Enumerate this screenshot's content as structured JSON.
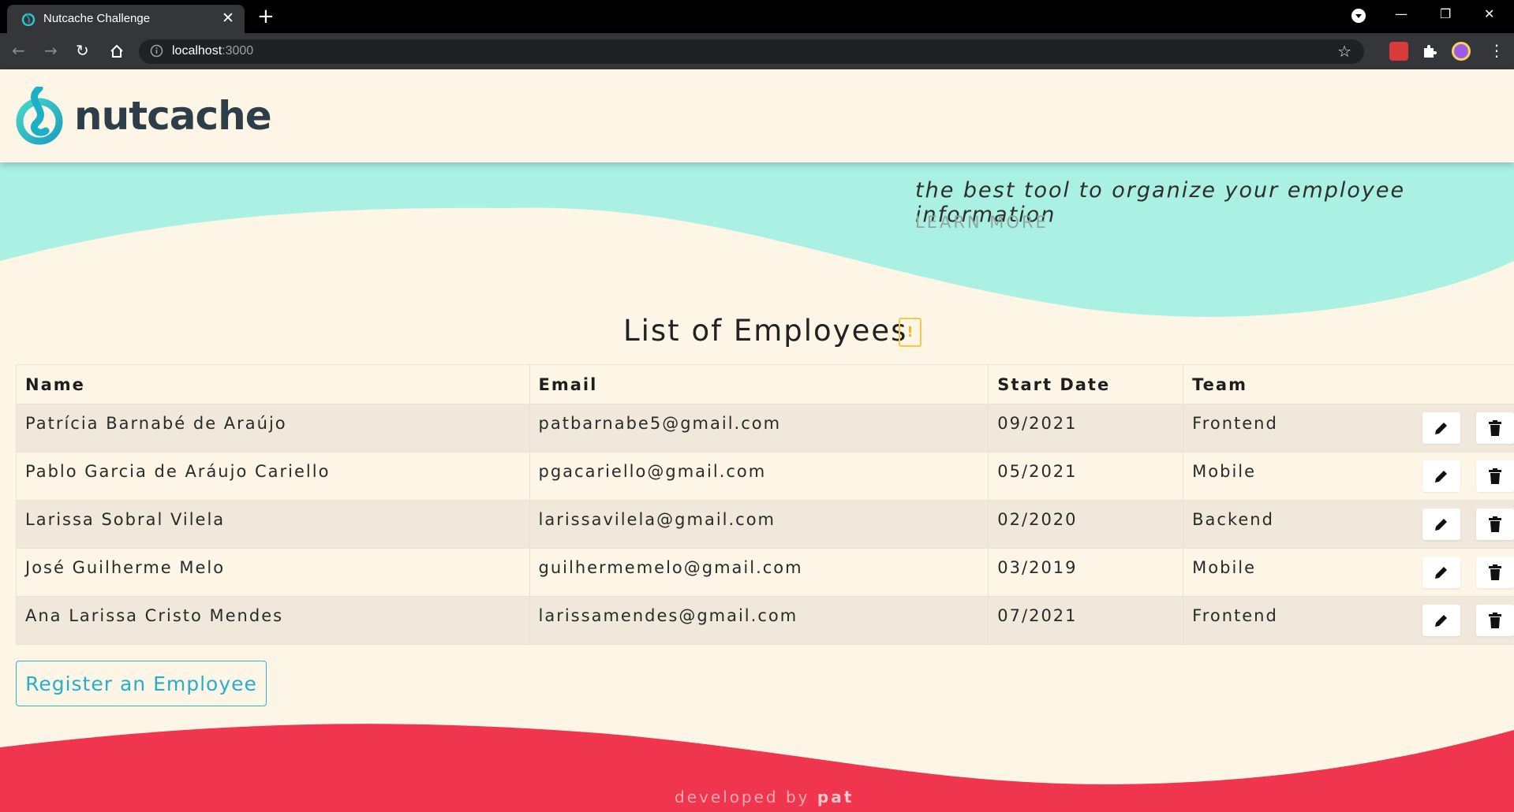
{
  "browser": {
    "tab_title": "Nutcache Challenge",
    "tab_close": "✕",
    "new_tab": "+",
    "url_host": "localhost",
    "url_port": ":3000",
    "window_controls": [
      "—",
      "❐",
      "✕"
    ]
  },
  "brand": {
    "logo_text": "nutcache",
    "accent_color": "#2ec4c9",
    "hero_color": "#aaf0e3",
    "footer_color": "#f0354e"
  },
  "hero": {
    "tagline": "the best tool to organize your employee information",
    "learn_more": "LEARN MORE"
  },
  "main": {
    "title": "List of Employees",
    "warning_badge": "!",
    "columns": [
      "Name",
      "Email",
      "Start Date",
      "Team"
    ],
    "employees": [
      {
        "name": "Patrícia Barnabé de Araújo",
        "email": "patbarnabe5@gmail.com",
        "start_date": "09/2021",
        "team": "Frontend"
      },
      {
        "name": "Pablo Garcia de Aráujo Cariello",
        "email": "pgacariello@gmail.com",
        "start_date": "05/2021",
        "team": "Mobile"
      },
      {
        "name": "Larissa Sobral Vilela",
        "email": "larissavilela@gmail.com",
        "start_date": "02/2020",
        "team": "Backend"
      },
      {
        "name": "José Guilherme Melo",
        "email": "guilhermemelo@gmail.com",
        "start_date": "03/2019",
        "team": "Mobile"
      },
      {
        "name": "Ana Larissa Cristo Mendes",
        "email": "larissamendes@gmail.com",
        "start_date": "07/2021",
        "team": "Frontend"
      }
    ],
    "register_button": "Register an Employee"
  },
  "footer": {
    "developed_by": "developed by",
    "author": "pat"
  }
}
